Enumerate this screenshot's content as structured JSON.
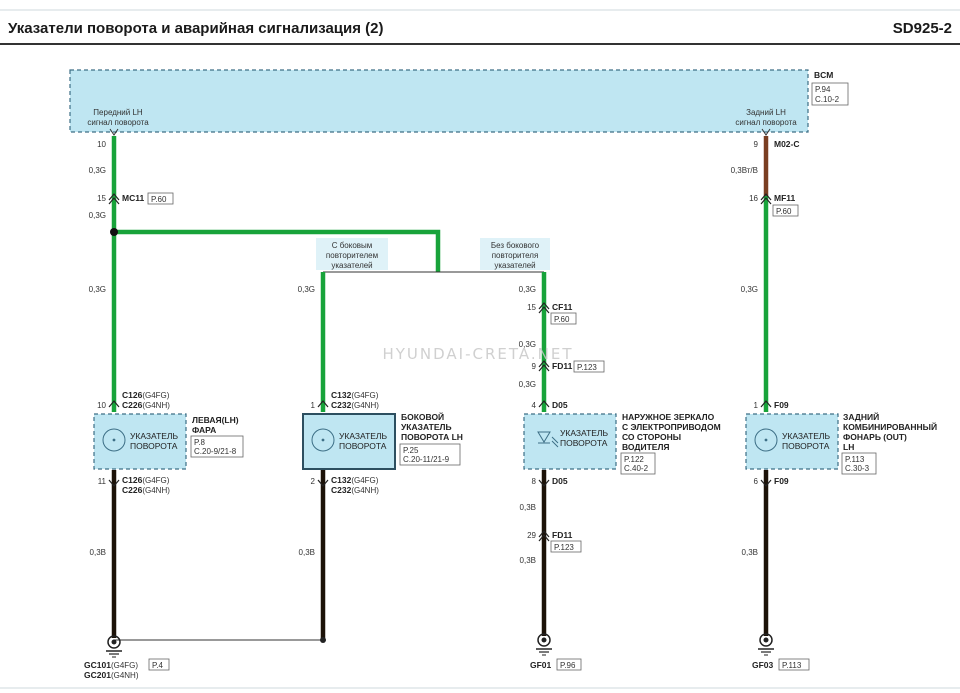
{
  "header": {
    "title": "Указатели поворота и аварийная сигнализация (2)",
    "code": "SD925-2"
  },
  "bcm": {
    "name": "BCM",
    "ref_page": "P.94",
    "ref_schema": "C.10-2",
    "left_pin_label_1": "Передний LH",
    "left_pin_label_2": "сигнал поворота",
    "right_pin_label_1": "Задний LH",
    "right_pin_label_2": "сигнал поворота"
  },
  "watermark": "HYUNDAI-CRETA.NET",
  "left": {
    "pin_bcm": "10",
    "wire_top": "0,3G",
    "mc11_pin": "15",
    "mc11_name": "MC11",
    "mc11_ref": "P.60",
    "wire_after_mc11": "0,3G",
    "wire_mid": "0,3G",
    "conn_top_pin": "10",
    "conn_top_1": "C126",
    "conn_top_1_suffix": "(G4FG)",
    "conn_top_2": "C226",
    "conn_top_2_suffix": "(G4NH)",
    "component_label_1": "УКАЗАТЕЛЬ",
    "component_label_2": "ПОВОРОТА",
    "name_1": "ЛЕВАЯ(LH)",
    "name_2": "ФАРА",
    "ref_page": "P.8",
    "ref_schema": "C.20-9/21-8",
    "conn_bot_pin": "11",
    "conn_bot_1": "C126",
    "conn_bot_1_suffix": "(G4FG)",
    "conn_bot_2": "C226",
    "conn_bot_2_suffix": "(G4NH)",
    "wire_bottom": "0,3B",
    "ground_1": "GC101",
    "ground_1_suffix": "(G4FG)",
    "ground_2": "GC201",
    "ground_2_suffix": "(G4NH)",
    "ground_ref": "P.4"
  },
  "branch": {
    "with_label_1": "С боковым",
    "with_label_2": "повторителем",
    "with_label_3": "указателей",
    "without_label_1": "Без бокового",
    "without_label_2": "повторителя",
    "without_label_3": "указателей"
  },
  "side": {
    "wire_top": "0,3G",
    "conn_top_pin": "1",
    "conn_top_1": "C132",
    "conn_top_1_suffix": "(G4FG)",
    "conn_top_2": "C232",
    "conn_top_2_suffix": "(G4NH)",
    "component_label_1": "УКАЗАТЕЛЬ",
    "component_label_2": "ПОВОРОТА",
    "name_1": "БОКОВОЙ",
    "name_2": "УКАЗАТЕЛЬ",
    "name_3": "ПОВОРОТА LH",
    "ref_page": "P.25",
    "ref_schema": "C.20-11/21-9",
    "conn_bot_pin": "2",
    "conn_bot_1": "C132",
    "conn_bot_1_suffix": "(G4FG)",
    "conn_bot_2": "C232",
    "conn_bot_2_suffix": "(G4NH)",
    "wire_bottom": "0,3B"
  },
  "mirror": {
    "wire_1": "0,3G",
    "cf11_pin": "15",
    "cf11_name": "CF11",
    "cf11_ref": "P.60",
    "wire_2": "0,3G",
    "fd11_pin": "9",
    "fd11_name": "FD11",
    "fd11_ref": "P.123",
    "wire_3": "0,3G",
    "d05_top_pin": "4",
    "d05_top_name": "D05",
    "component_label_1": "УКАЗАТЕЛЬ",
    "component_label_2": "ПОВОРОТА",
    "name_1": "НАРУЖНОЕ ЗЕРКАЛО",
    "name_2": "С ЭЛЕКТРОПРИВОДОМ",
    "name_3": "СО СТОРОНЫ",
    "name_4": "ВОДИТЕЛЯ",
    "ref_page": "P.122",
    "ref_schema": "C.40-2",
    "d05_bot_pin": "8",
    "d05_bot_name": "D05",
    "wire_4": "0,3B",
    "fd11b_pin": "29",
    "fd11b_name": "FD11",
    "fd11b_ref": "P.123",
    "wire_5": "0,3B",
    "ground": "GF01",
    "ground_ref": "P.96"
  },
  "rear": {
    "pin_bcm": "9",
    "m02_name": "M02-C",
    "wire_1": "0,3Вт/B",
    "mf11_pin": "16",
    "mf11_name": "MF11",
    "mf11_ref": "P.60",
    "wire_2": "0,3G",
    "f09_top_pin": "1",
    "f09_top_name": "F09",
    "component_label_1": "УКАЗАТЕЛЬ",
    "component_label_2": "ПОВОРОТА",
    "name_1": "ЗАДНИЙ",
    "name_2": "КОМБИНИРОВАННЫЙ",
    "name_3": "ФОНАРЬ (OUT)",
    "name_4": "LH",
    "ref_page": "P.113",
    "ref_schema": "C.30-3",
    "f09_bot_pin": "6",
    "f09_bot_name": "F09",
    "wire_3": "0,3B",
    "ground": "GF03",
    "ground_ref": "P.113"
  },
  "colors": {
    "wire_green": "#18a33a",
    "wire_black": "#1c1208",
    "wire_brown": "#7a3e22",
    "box_fill": "#bfe6f2",
    "box_border": "#3d6f86"
  }
}
